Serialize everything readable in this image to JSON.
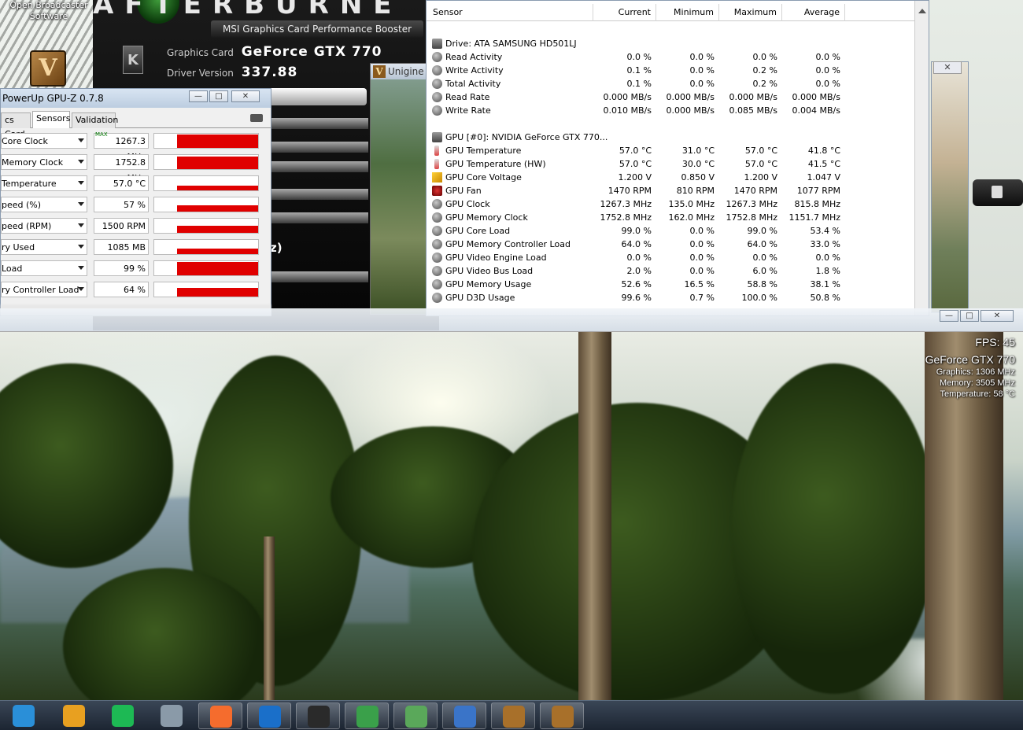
{
  "desktop": {
    "icons": [
      {
        "label": "Open Broadcaster Software"
      }
    ]
  },
  "afterburner": {
    "title": "AFTERBURNE",
    "subtitle": "MSI Graphics Card Performance Booster",
    "graphics_card_label": "Graphics Card",
    "graphics_card_value": "GeForce GTX 770",
    "driver_label": "Driver Version",
    "driver_value": "337.88",
    "k_button": "K",
    "partial_text": "z)"
  },
  "unigine": {
    "title": "Unigine",
    "icon_letter": "V"
  },
  "gpuz": {
    "title": "PowerUp GPU-Z 0.7.8",
    "window_buttons": {
      "minimize": "—",
      "maximize": "□",
      "close": "✕"
    },
    "tabs": [
      "cs Card",
      "Sensors",
      "Validation"
    ],
    "active_tab": "Sensors",
    "max_tag": "MAX",
    "sensors": [
      {
        "label": "Core Clock",
        "value": "1267.3 MHz",
        "level": 0.95
      },
      {
        "label": "Memory Clock",
        "value": "1752.8 MHz",
        "level": 0.9
      },
      {
        "label": "Temperature",
        "value": "57.0 °C",
        "level": 0.35
      },
      {
        "label": "peed (%)",
        "value": "57 %",
        "level": 0.45
      },
      {
        "label": "peed (RPM)",
        "value": "1500 RPM",
        "level": 0.5
      },
      {
        "label": "ry Used",
        "value": "1085 MB",
        "level": 0.4
      },
      {
        "label": "Load",
        "value": "99 %",
        "level": 0.95
      },
      {
        "label": "ry Controller Load",
        "value": "64 %",
        "level": 0.6
      }
    ]
  },
  "hwinfo": {
    "columns": [
      "Sensor",
      "Current",
      "Minimum",
      "Maximum",
      "Average"
    ],
    "groups": [
      {
        "title": "Drive: ATA SAMSUNG HD501LJ",
        "rows": [
          {
            "name": "Read Activity",
            "icon": "disk-icon",
            "cur": "0.0 %",
            "min": "0.0 %",
            "max": "0.0 %",
            "avg": "0.0 %"
          },
          {
            "name": "Write Activity",
            "icon": "disk-icon",
            "cur": "0.1 %",
            "min": "0.0 %",
            "max": "0.2 %",
            "avg": "0.0 %"
          },
          {
            "name": "Total Activity",
            "icon": "disk-icon",
            "cur": "0.1 %",
            "min": "0.0 %",
            "max": "0.2 %",
            "avg": "0.0 %"
          },
          {
            "name": "Read Rate",
            "icon": "disk-icon",
            "cur": "0.000 MB/s",
            "min": "0.000 MB/s",
            "max": "0.000 MB/s",
            "avg": "0.000 MB/s"
          },
          {
            "name": "Write Rate",
            "icon": "disk-icon",
            "cur": "0.010 MB/s",
            "min": "0.000 MB/s",
            "max": "0.085 MB/s",
            "avg": "0.004 MB/s"
          }
        ]
      },
      {
        "title": "GPU [#0]: NVIDIA GeForce GTX 770...",
        "rows": [
          {
            "name": "GPU Temperature",
            "icon": "thermometer-icon",
            "cur": "57.0 °C",
            "min": "31.0 °C",
            "max": "57.0 °C",
            "avg": "41.8 °C"
          },
          {
            "name": "GPU Temperature (HW)",
            "icon": "thermometer-icon",
            "cur": "57.0 °C",
            "min": "30.0 °C",
            "max": "57.0 °C",
            "avg": "41.5 °C"
          },
          {
            "name": "GPU Core Voltage",
            "icon": "lightning-icon",
            "cur": "1.200 V",
            "min": "0.850 V",
            "max": "1.200 V",
            "avg": "1.047 V"
          },
          {
            "name": "GPU Fan",
            "icon": "fan-icon",
            "cur": "1470 RPM",
            "min": "810 RPM",
            "max": "1470 RPM",
            "avg": "1077 RPM"
          },
          {
            "name": "GPU Clock",
            "icon": "gauge-icon",
            "cur": "1267.3 MHz",
            "min": "135.0 MHz",
            "max": "1267.3 MHz",
            "avg": "815.8 MHz"
          },
          {
            "name": "GPU Memory Clock",
            "icon": "gauge-icon",
            "cur": "1752.8 MHz",
            "min": "162.0 MHz",
            "max": "1752.8 MHz",
            "avg": "1151.7 MHz"
          },
          {
            "name": "GPU Core Load",
            "icon": "gauge-icon",
            "cur": "99.0 %",
            "min": "0.0 %",
            "max": "99.0 %",
            "avg": "53.4 %"
          },
          {
            "name": "GPU Memory Controller Load",
            "icon": "gauge-icon",
            "cur": "64.0 %",
            "min": "0.0 %",
            "max": "64.0 %",
            "avg": "33.0 %"
          },
          {
            "name": "GPU Video Engine Load",
            "icon": "gauge-icon",
            "cur": "0.0 %",
            "min": "0.0 %",
            "max": "0.0 %",
            "avg": "0.0 %"
          },
          {
            "name": "GPU Video Bus Load",
            "icon": "gauge-icon",
            "cur": "2.0 %",
            "min": "0.0 %",
            "max": "6.0 %",
            "avg": "1.8 %"
          },
          {
            "name": "GPU Memory Usage",
            "icon": "gauge-icon",
            "cur": "52.6 %",
            "min": "16.5 %",
            "max": "58.8 %",
            "avg": "38.1 %"
          },
          {
            "name": "GPU D3D Usage",
            "icon": "gauge-icon",
            "cur": "99.6 %",
            "min": "0.7 %",
            "max": "100.0 %",
            "avg": "50.8 %"
          }
        ]
      }
    ]
  },
  "game": {
    "window_buttons": {
      "minimize": "—",
      "maximize": "□",
      "close": "✕"
    },
    "osd": {
      "fps": "FPS: 45",
      "gpu": "GeForce GTX 770",
      "graphics": "Graphics: 1306 MHz",
      "memory": "Memory: 3505 MHz",
      "temperature": "Temperature: 58 °C"
    }
  },
  "taskbar": {
    "items": [
      {
        "name": "media-player-icon",
        "color": "#2a8fd8",
        "open": false
      },
      {
        "name": "winamp-icon",
        "color": "#e8a020",
        "open": false
      },
      {
        "name": "spotify-icon",
        "color": "#1db954",
        "open": false
      },
      {
        "name": "steam-chat-icon",
        "color": "#8a9aa8",
        "open": false
      },
      {
        "name": "origin-icon",
        "color": "#f56c2d",
        "open": true
      },
      {
        "name": "battlenet-icon",
        "color": "#1a6fc9",
        "open": true
      },
      {
        "name": "steam-icon",
        "color": "#2a2a2a",
        "open": true
      },
      {
        "name": "xbox-shield-icon",
        "color": "#3aa04a",
        "open": true
      },
      {
        "name": "network-map-icon",
        "color": "#5aa85a",
        "open": true
      },
      {
        "name": "settings-panel-icon",
        "color": "#3a74c8",
        "open": true
      },
      {
        "name": "valley-icon-1",
        "color": "#a8702a",
        "open": true
      },
      {
        "name": "valley-icon-2",
        "color": "#a8702a",
        "open": true
      }
    ]
  }
}
